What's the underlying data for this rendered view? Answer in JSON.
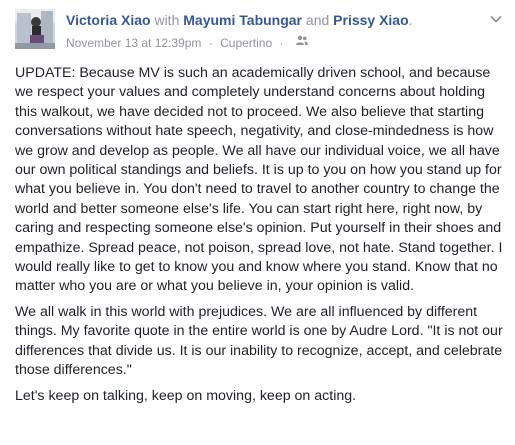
{
  "post": {
    "author": "Victoria Xiao",
    "with_word": "with",
    "tagged_1": "Mayumi Tabungar",
    "and_word": "and",
    "tagged_2": "Prissy Xiao",
    "period": ".",
    "timestamp": "November 13 at 12:39pm",
    "separator": "·",
    "location": "Cupertino",
    "separator_2": "·",
    "audience_icon": "friends-icon",
    "menu_icon": "chevron-down-icon",
    "paragraphs": [
      "UPDATE: Because MV is such an academically driven school, and because we respect your values and completely understand concerns about holding this walkout, we have decided not to proceed. We also believe that starting conversations without hate speech, negativity, and close-mindedness is how we grow and develop as people. We all have our individual voice, we all have our own political standings and beliefs. It is up to you on how you stand up for what you believe in. You don't need to travel to another country to change the world and better someone else's life. You can start right here, right now, by caring and respecting someone else's opinion. Put yourself in their shoes and empathize. Spread peace, not poison, spread love, not hate. Stand together. I would really like to get to know you and know where you stand. Know that no matter who you are or what you believe in, your opinion is valid.",
      "We all walk in this world with prejudices. We are all influenced by different things. My favorite quote in the entire world is one by Audre Lord. \"It is not our differences that divide us. It is our inability to recognize, accept, and celebrate those differences.\"",
      "Let's keep on talking, keep on moving, keep on acting."
    ]
  },
  "colors": {
    "link": "#365899",
    "meta": "#90949c",
    "text": "#1d2129"
  }
}
